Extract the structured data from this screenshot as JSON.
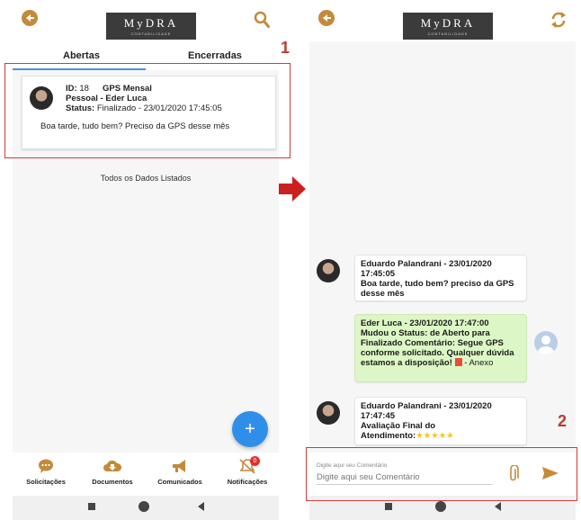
{
  "app": {
    "logo_text": "MyDRA",
    "logo_sub": "CONTABILIDADE"
  },
  "list_screen": {
    "tabs": [
      "Abertas",
      "Encerradas"
    ],
    "card": {
      "id_label": "ID:",
      "id_value": "18",
      "title_line1": "GPS Mensal",
      "title_line2": "Pessoal - Eder Luca",
      "status_label": "Status:",
      "status_value": "Finalizado - 23/01/2020 17:45:05",
      "message": "Boa tarde, tudo bem? Preciso da GPS desse mês"
    },
    "listed_text": "Todos os Dados Listados",
    "fab_label": "+",
    "nav": [
      {
        "label": "Solicitações",
        "icon": "chat-icon"
      },
      {
        "label": "Documentos",
        "icon": "cloud-download-icon"
      },
      {
        "label": "Comunicados",
        "icon": "megaphone-icon"
      },
      {
        "label": "Notificações",
        "icon": "bell-off-icon",
        "badge": "0"
      }
    ]
  },
  "chat_screen": {
    "messages": [
      {
        "header": "Eduardo Palandrani - 23/01/2020 17:45:05",
        "body": "Boa tarde, tudo bem? preciso da GPS desse mês"
      },
      {
        "header": "Eder Luca - 23/01/2020 17:47:00",
        "body": "Mudou o Status: de Aberto para Finalizado Comentário: Segue GPS conforme solicitado. Qualquer dúvida estamos a disposição!",
        "attachment": "- Anexo"
      },
      {
        "header": "Eduardo Palandrani - 23/01/2020 17:47:45",
        "body": "Avaliação Final do Atendimento:",
        "stars": "★★★★★"
      }
    ],
    "composer": {
      "label": "Digite aqui seu Comentário",
      "placeholder": "Digite aqui seu Comentário"
    }
  },
  "annotations": {
    "step1": "1",
    "step2": "2"
  },
  "colors": {
    "accent_brown": "#c48a3b",
    "fab_blue": "#2f8fe8",
    "frame_red": "#d23a3a",
    "outgoing_bubble": "#dcf7c5"
  }
}
